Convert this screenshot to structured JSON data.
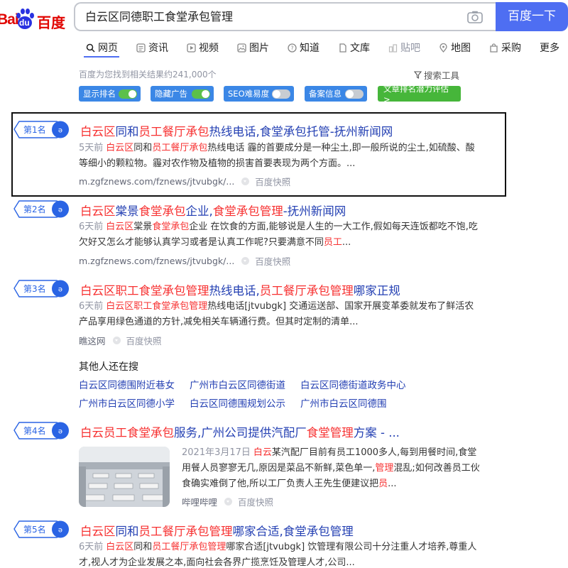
{
  "logo": {
    "bai": "Bai",
    "du": "du",
    "cn": "百度"
  },
  "search": {
    "query": "白云区同德职工食堂承包管理",
    "button": "百度一下"
  },
  "tabs": [
    {
      "label": "网页",
      "icon": "search-icon"
    },
    {
      "label": "资讯",
      "icon": "news-icon"
    },
    {
      "label": "视频",
      "icon": "video-icon"
    },
    {
      "label": "图片",
      "icon": "image-icon"
    },
    {
      "label": "知道",
      "icon": "question-icon"
    },
    {
      "label": "文库",
      "icon": "document-icon"
    },
    {
      "label": "贴吧",
      "icon": "tieba-icon"
    },
    {
      "label": "地图",
      "icon": "map-icon"
    },
    {
      "label": "采购",
      "icon": "purchase-icon"
    },
    {
      "label": "更多",
      "icon": ""
    }
  ],
  "result_count": "百度为您找到相关结果约241,000个",
  "tools_label": "搜索工具",
  "toggles": [
    {
      "label": "显示排名",
      "state": "on"
    },
    {
      "label": "隐藏广告",
      "state": "on"
    },
    {
      "label": "SEO难易度",
      "state": "off"
    },
    {
      "label": "备案信息",
      "state": "off"
    }
  ],
  "rank_eval_button": "文章排名潜力评估 >",
  "results": [
    {
      "rank": "第1名",
      "title": [
        [
          "白云区",
          true
        ],
        [
          "同和",
          false
        ],
        [
          "员工餐厅承包",
          true
        ],
        [
          "热线电话,食堂承包托管-抚州新闻网",
          false
        ]
      ],
      "time": "5天前",
      "abstract": [
        [
          "白云区",
          true
        ],
        [
          "同和",
          false
        ],
        [
          "员工餐厅承包",
          true
        ],
        [
          "热线电话 霾的首要成分是一种尘土,即一般所说的尘土,如硫酸、酸等细小的颗粒物。霾对农作物及植物的损害首要表现为两个方面。...",
          false
        ]
      ],
      "source": "m.zgfznews.com/fznews/jtvubgk/...",
      "snapshot": "百度快照"
    },
    {
      "rank": "第2名",
      "title": [
        [
          "白云区",
          true
        ],
        [
          "棠景",
          false
        ],
        [
          "食堂承包",
          true
        ],
        [
          "企业,",
          false
        ],
        [
          "食堂承包管理",
          true
        ],
        [
          "-抚州新闻网",
          false
        ]
      ],
      "time": "6天前",
      "abstract": [
        [
          "白云区",
          true
        ],
        [
          "棠景",
          false
        ],
        [
          "食堂承包",
          true
        ],
        [
          "企业 在饮食的方面,能够说是人生的一大工作,假如每天连饭都吃不饱,吃欠好又怎么才能够认真学习或者是认真工作呢?只要满意不同",
          false
        ],
        [
          "员工",
          true
        ],
        [
          "...",
          false
        ]
      ],
      "source": "m.zgfznews.com/fznews/jtvubgk/...",
      "snapshot": "百度快照"
    },
    {
      "rank": "第3名",
      "title": [
        [
          "白云区职工食堂承包管理",
          true
        ],
        [
          "热线电话,",
          false
        ],
        [
          "员工餐厅承包管理",
          true
        ],
        [
          "哪家正规",
          false
        ]
      ],
      "time": "6天前",
      "abstract": [
        [
          "白云区职工食堂承包管理",
          true
        ],
        [
          "热线电话[jtvubgk] 交通运送部、国家开展变革委就发布了鲜活农产品享用绿色通道的方针,减免相关车辆通行费。但其时定制的清单...",
          false
        ]
      ],
      "source": "瞧这网",
      "snapshot": "百度快照"
    },
    {
      "rank": "第4名",
      "title": [
        [
          "白云员工食堂承包",
          true
        ],
        [
          "服务,广州公司提供汽配厂",
          false
        ],
        [
          "食堂管理",
          true
        ],
        [
          "方案 - ...",
          false
        ]
      ],
      "time": "2021年3月17日",
      "abstract": [
        [
          "白云",
          true
        ],
        [
          "某汽配厂目前有员工1000多人,每到用餐时间,食堂用餐人员寥寥无几,原因是菜品不新鲜,菜色单一,",
          false
        ],
        [
          "管理",
          true
        ],
        [
          "混乱;如何改善员工伙食确实难倒了他,所以工厂负责人王先生便建议把",
          false
        ],
        [
          "员",
          true
        ],
        [
          "...",
          false
        ]
      ],
      "source": "哔哩哔哩",
      "snapshot": "百度快照"
    },
    {
      "rank": "第5名",
      "title": [
        [
          "白云区",
          true
        ],
        [
          "同和",
          false
        ],
        [
          "员工餐厅承包管理",
          true
        ],
        [
          "哪家合适,食堂承包管理",
          false
        ]
      ],
      "time": "6天前",
      "abstract": [
        [
          "白云区",
          true
        ],
        [
          "同和",
          false
        ],
        [
          "员工餐厅承包管理",
          true
        ],
        [
          "哪家合适[jtvubgk] 饮管理有限公司十分注重人才培养,尊重人才,视人才为企业发展之本,面向社会各界广揽烹饪及管理人才,公司...",
          false
        ]
      ],
      "source": "",
      "snapshot": ""
    }
  ],
  "others": {
    "title": "其他人还在搜",
    "links": [
      "白云区同德围附近巷女",
      "广州市白云区同德街道",
      "白云区同德街道政务中心",
      "广州市白云区同德小学",
      "白云区同德围规划公示",
      "广州市白云区同德围"
    ]
  },
  "colors": {
    "accent": "#4e6ef2",
    "link": "#2440b3",
    "highlight": "#f73131",
    "rank_badge": "#2a64e4"
  }
}
